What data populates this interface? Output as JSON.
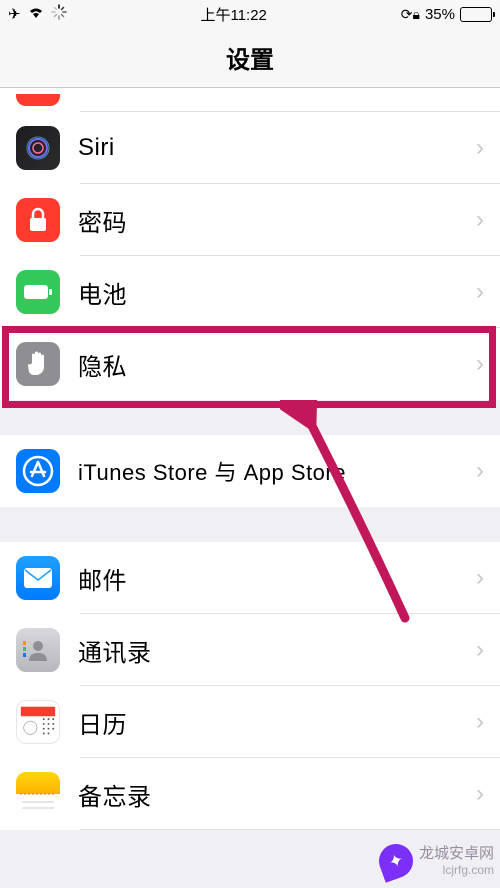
{
  "status": {
    "time": "上午11:22",
    "battery_pct": "35%"
  },
  "nav": {
    "title": "设置"
  },
  "rows": {
    "siri": "Siri",
    "password": "密码",
    "battery": "电池",
    "privacy": "隐私",
    "itunes": "iTunes Store 与 App Store",
    "mail": "邮件",
    "contacts": "通讯录",
    "calendar": "日历",
    "notes": "备忘录"
  },
  "watermark": {
    "name": "龙城安卓网",
    "url": "lcjrfg.com"
  }
}
